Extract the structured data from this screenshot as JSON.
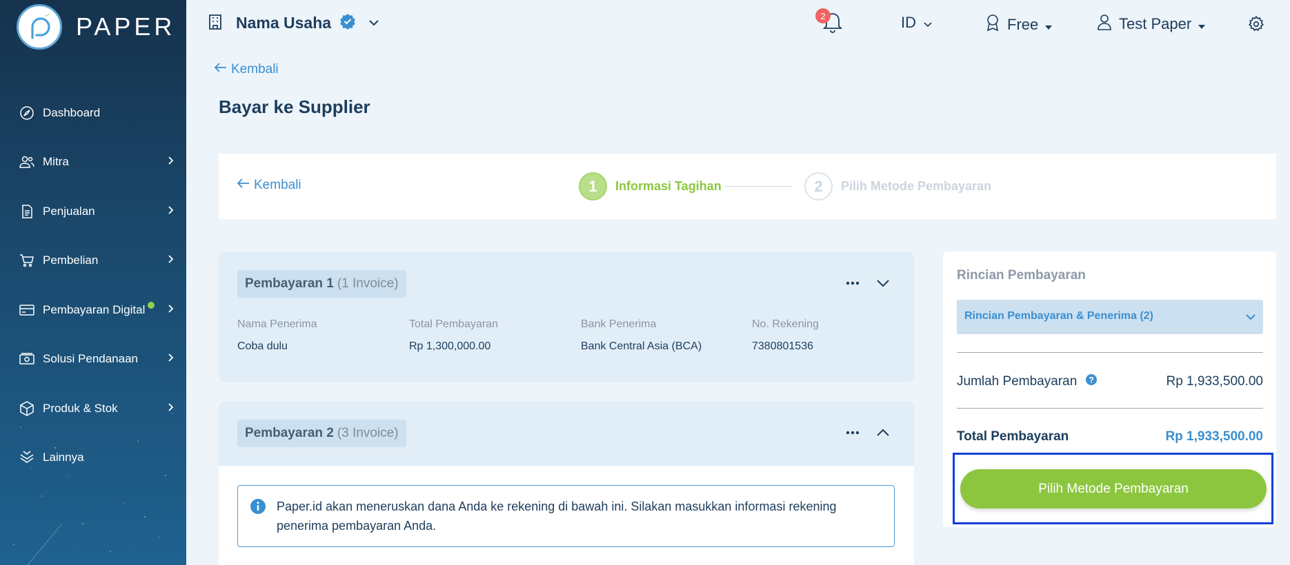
{
  "brand": {
    "name": "PAPER"
  },
  "sidebar": {
    "items": [
      {
        "label": "Dashboard",
        "icon": "compass-icon",
        "has_chevron": false
      },
      {
        "label": "Mitra",
        "icon": "users-icon",
        "has_chevron": true
      },
      {
        "label": "Penjualan",
        "icon": "document-icon",
        "has_chevron": true
      },
      {
        "label": "Pembelian",
        "icon": "cart-icon",
        "has_chevron": true
      },
      {
        "label": "Pembayaran Digital",
        "icon": "card-icon",
        "has_chevron": true,
        "dot": true
      },
      {
        "label": "Solusi Pendanaan",
        "icon": "money-icon",
        "has_chevron": true
      },
      {
        "label": "Produk & Stok",
        "icon": "box-icon",
        "has_chevron": true
      },
      {
        "label": "Lainnya",
        "icon": "stack-icon",
        "has_chevron": false
      }
    ]
  },
  "topbar": {
    "business_name": "Nama Usaha",
    "notification_count": "2",
    "language": "ID",
    "plan": "Free",
    "user": "Test Paper"
  },
  "page": {
    "back_label": "Kembali",
    "title": "Bayar ke Supplier"
  },
  "stepper": {
    "back_label": "Kembali",
    "steps": [
      {
        "num": "1",
        "label": "Informasi Tagihan",
        "active": true
      },
      {
        "num": "2",
        "label": "Pilih Metode Pembayaran",
        "active": false
      }
    ]
  },
  "payments": [
    {
      "title": "Pembayaran 1",
      "count": "(1 Invoice)",
      "columns": [
        "Nama Penerima",
        "Total Pembayaran",
        "Bank Penerima",
        "No. Rekening"
      ],
      "values": [
        "Coba dulu",
        "Rp 1,300,000.00",
        "Bank Central Asia (BCA)",
        "7380801536"
      ]
    },
    {
      "title": "Pembayaran 2",
      "count": "(3 Invoice)",
      "info": "Paper.id akan meneruskan dana Anda ke rekening di bawah ini. Silakan masukkan informasi rekening penerima pembayaran Anda."
    }
  ],
  "summary": {
    "title": "Rincian Pembayaran",
    "accordion_label": "Rincian Pembayaran & Penerima (2)",
    "amount_label": "Jumlah Pembayaran",
    "amount_value": "Rp 1,933,500.00",
    "total_label": "Total Pembayaran",
    "total_value": "Rp 1,933,500.00",
    "cta_label": "Pilih Metode Pembayaran"
  },
  "colors": {
    "accent_blue": "#3b8fd0",
    "accent_green": "#8cc63f",
    "sidebar_top": "#15324d",
    "sidebar_bottom": "#1f6290",
    "highlight_border": "#0a3fd8"
  }
}
